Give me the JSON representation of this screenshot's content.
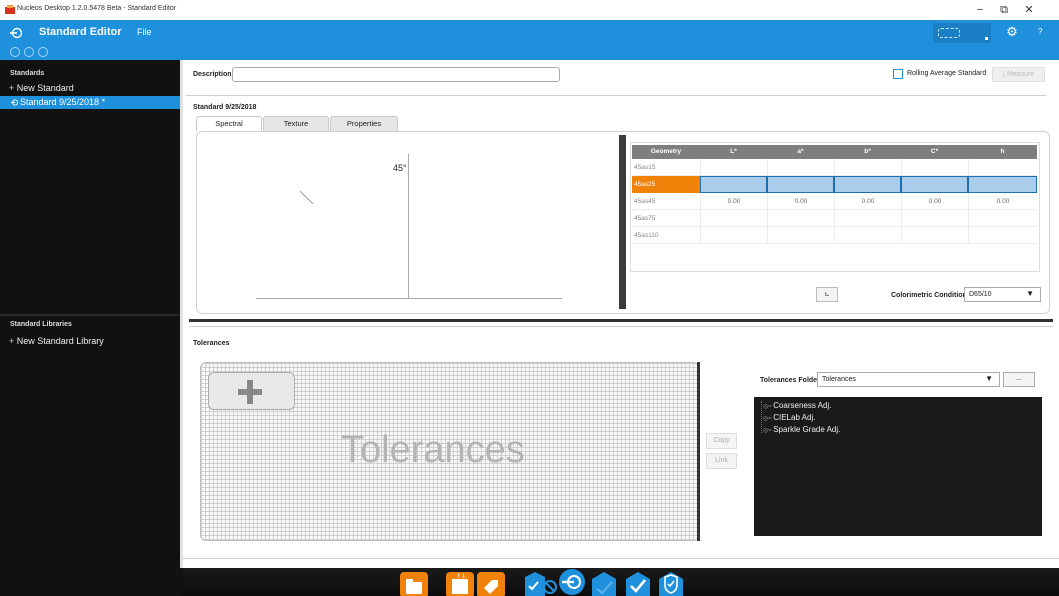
{
  "window": {
    "title": "Nucleos Desktop 1.2.0.5478 Beta - Standard Editor",
    "minimize": "−",
    "restore": "⧉",
    "close": "✕"
  },
  "app": {
    "title": "Standard Editor",
    "file_menu": "File",
    "help": "?"
  },
  "colors": {
    "accent": "#1e90dc",
    "orange": "#f0820a",
    "dark": "#111111"
  },
  "sidebar": {
    "standards_title": "Standards",
    "new_standard": "New Standard",
    "selected_standard": "Standard 9/25/2018 *",
    "libraries_title": "Standard Libraries",
    "new_library": "New Standard Library"
  },
  "editor": {
    "description_label": "Description",
    "description_value": "",
    "rolling_average_label": "Rolling Average Standard",
    "measure_label": "Measure",
    "standard_heading": "Standard 9/25/2018",
    "tabs": [
      "Spectral",
      "Texture",
      "Properties"
    ],
    "angle_label": "45°",
    "colorimetric_label": "Colorimetric Condition:",
    "colorimetric_value": "D65/10"
  },
  "geometry_table": {
    "headers": [
      "Geometry",
      "L*",
      "a*",
      "b*",
      "C*",
      "h"
    ],
    "rows": [
      {
        "name": "45as15",
        "values": [
          "",
          "",
          "",
          "",
          ""
        ]
      },
      {
        "name": "45as25",
        "values": [
          "",
          "",
          "",
          "",
          ""
        ],
        "selected": true
      },
      {
        "name": "45as45",
        "values": [
          "0.00",
          "0.00",
          "0.00",
          "0.00",
          "0.00"
        ]
      },
      {
        "name": "45as75",
        "values": [
          "",
          "",
          "",
          "",
          ""
        ]
      },
      {
        "name": "45as110",
        "values": [
          "",
          "",
          "",
          "",
          ""
        ]
      }
    ]
  },
  "tolerances": {
    "heading": "Tolerances",
    "watermark": "Tolerances",
    "copy_label": "Copy",
    "link_label": "Link",
    "folder_label": "Tolerances Folder",
    "folder_value": "Tolerances",
    "browse_label": "...",
    "items": [
      "Coarseness Adj.",
      "CIELab Adj.",
      "Sparkle Grade Adj."
    ]
  },
  "dock_icons": [
    "folder-icon",
    "save-icon",
    "tag-icon",
    "check-cancel-icon",
    "standard-editor-icon",
    "shield-check-icon",
    "check-icon",
    "verified-shield-icon"
  ]
}
